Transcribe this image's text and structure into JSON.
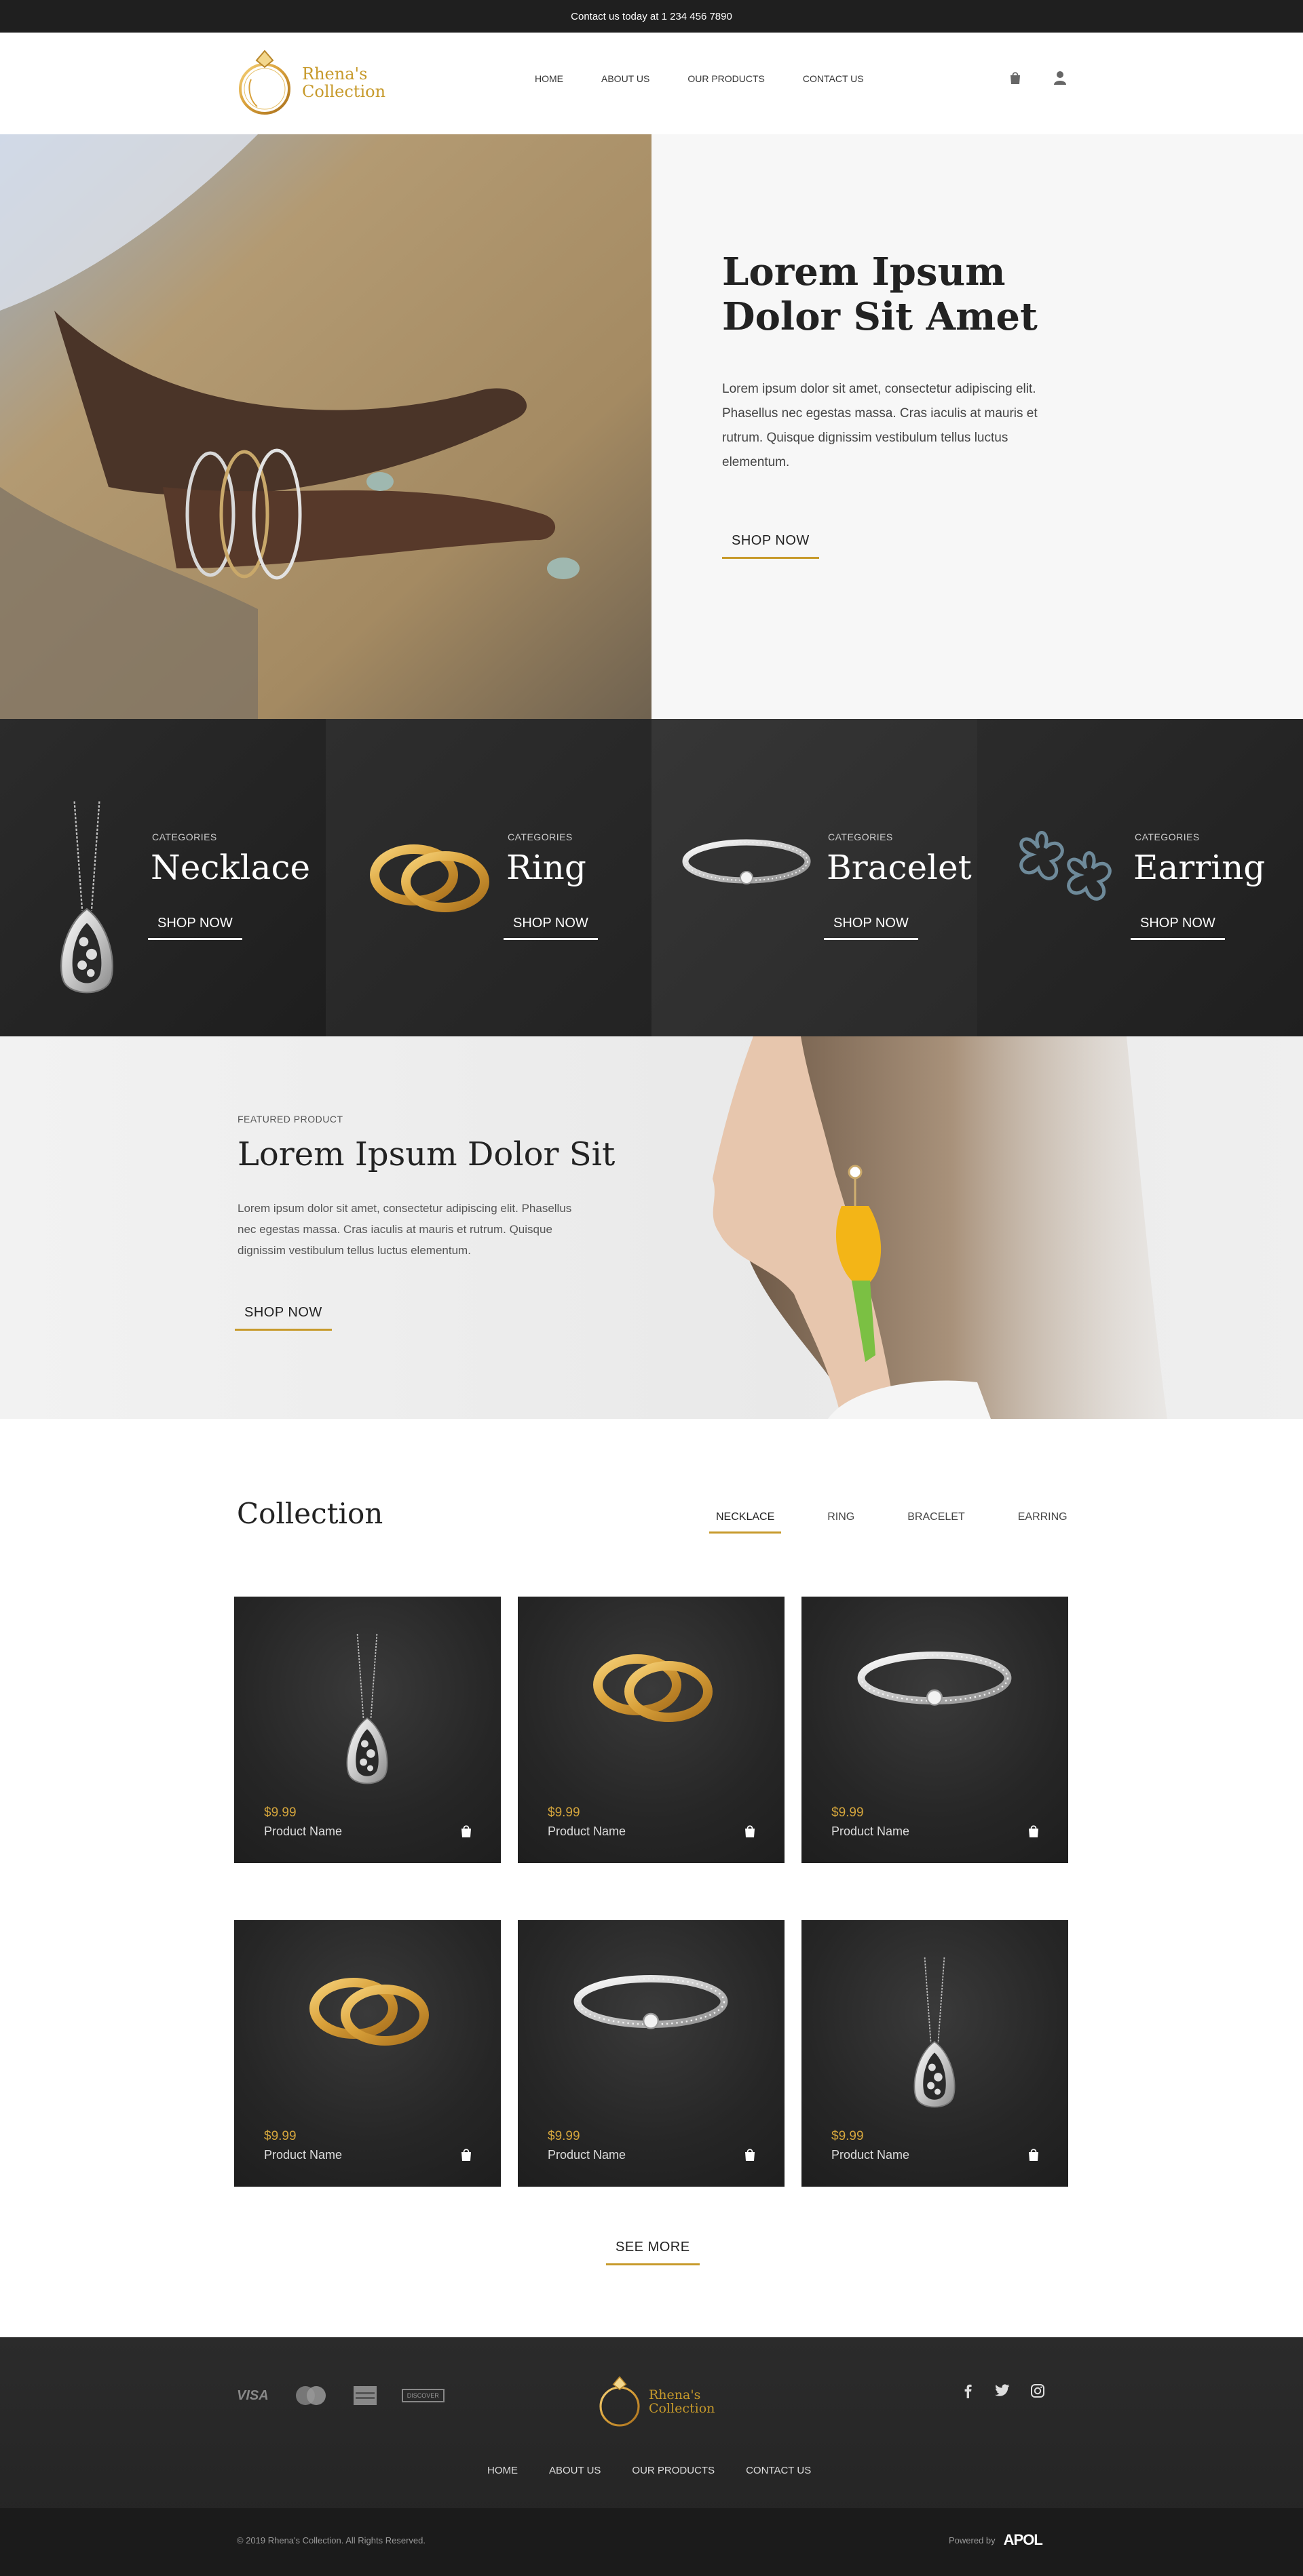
{
  "topbar": {
    "contact": "Contact us today at 1 234 456 7890"
  },
  "brand": {
    "line1": "Rhena's",
    "line2": "Collection",
    "gold": "#c79a2b"
  },
  "nav": {
    "home": "HOME",
    "about": "ABOUT US",
    "products": "OUR PRODUCTS",
    "contact": "CONTACT US"
  },
  "header_icons": [
    "shopping-bag-icon",
    "user-icon"
  ],
  "hero": {
    "title": "Lorem Ipsum Dolor Sit Amet",
    "description": "Lorem ipsum dolor sit amet, consectetur adipiscing elit. Phasellus nec egestas massa. Cras iaculis at mauris et rutrum. Quisque dignissim vestibulum tellus luctus elementum.",
    "button": "SHOP NOW"
  },
  "categories": [
    {
      "label": "CATEGORIES",
      "name": "Necklace",
      "button": "SHOP NOW"
    },
    {
      "label": "CATEGORIES",
      "name": "Ring",
      "button": "SHOP NOW"
    },
    {
      "label": "CATEGORIES",
      "name": "Bracelet",
      "button": "SHOP NOW"
    },
    {
      "label": "CATEGORIES",
      "name": "Earring",
      "button": "SHOP NOW"
    }
  ],
  "featured": {
    "label": "FEATURED PRODUCT",
    "title": "Lorem Ipsum Dolor Sit",
    "description": "Lorem ipsum dolor sit amet, consectetur adipiscing elit. Phasellus nec egestas massa. Cras iaculis at mauris et rutrum. Quisque dignissim vestibulum tellus luctus elementum.",
    "button": "SHOP NOW"
  },
  "collection": {
    "title": "Collection",
    "tabs": [
      "NECKLACE",
      "RING",
      "BRACELET",
      "EARRING"
    ],
    "active_tab": "NECKLACE",
    "products": [
      {
        "price": "$9.99",
        "name": "Product Name",
        "image": "necklace"
      },
      {
        "price": "$9.99",
        "name": "Product Name",
        "image": "ring"
      },
      {
        "price": "$9.99",
        "name": "Product Name",
        "image": "bracelet"
      },
      {
        "price": "$9.99",
        "name": "Product Name",
        "image": "ring"
      },
      {
        "price": "$9.99",
        "name": "Product Name",
        "image": "bracelet"
      },
      {
        "price": "$9.99",
        "name": "Product Name",
        "image": "necklace"
      }
    ],
    "see_more": "SEE MORE"
  },
  "footer": {
    "payments": [
      "VISA",
      "mastercard",
      "amex",
      "DISCOVER"
    ],
    "social": [
      "facebook-icon",
      "twitter-icon",
      "instagram-icon"
    ],
    "nav": {
      "home": "HOME",
      "about": "ABOUT US",
      "products": "OUR PRODUCTS",
      "contact": "CONTACT US"
    },
    "copyright": "© 2019 Rhena's Collection. All Rights Reserved.",
    "powered_by": "Powered by",
    "powered_logo": "APOL"
  }
}
